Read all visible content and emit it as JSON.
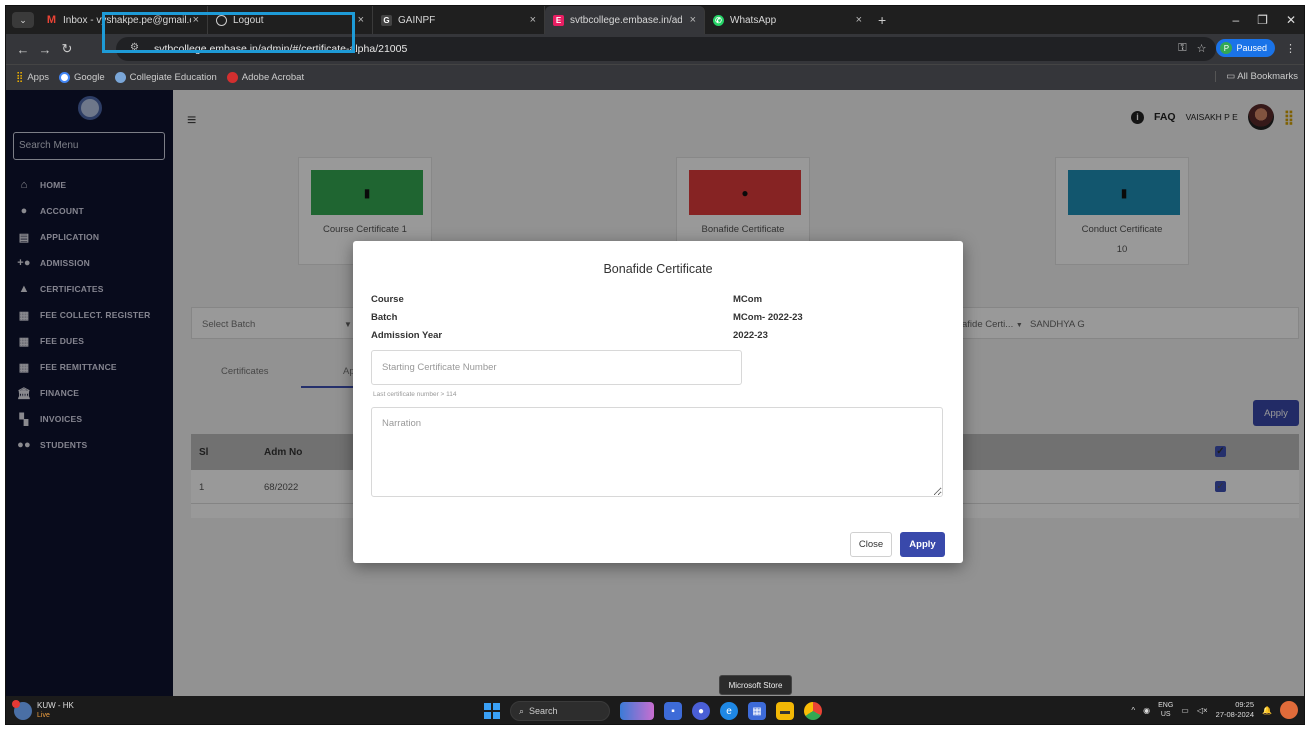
{
  "browser": {
    "tabs": [
      {
        "label": "Inbox - vyshakpe.pe@gmail.co",
        "icon": "gmail-icon",
        "active": false
      },
      {
        "label": "Logout",
        "icon": "globe-icon",
        "active": false
      },
      {
        "label": "GAINPF",
        "icon": "gainpf-icon",
        "active": false
      },
      {
        "label": "svtbcollege.embase.in/admin/#",
        "icon": "embase-icon",
        "active": true
      },
      {
        "label": "WhatsApp",
        "icon": "whatsapp-icon",
        "active": false
      }
    ],
    "new_tab": "+",
    "url": "svtbcollege.embase.in/admin/#/certificate-alpha/21005",
    "profile_status": "Paused",
    "profile_initial": "P",
    "bookmarks": [
      {
        "label": "Apps",
        "icon": "apps-grid-icon"
      },
      {
        "label": "Google",
        "icon": "google-icon"
      },
      {
        "label": "Collegiate Education",
        "icon": "college-icon"
      },
      {
        "label": "Adobe Acrobat",
        "icon": "acrobat-icon"
      }
    ],
    "all_bookmarks": "All Bookmarks"
  },
  "sidebar": {
    "search_placeholder": "Search Menu",
    "items": [
      {
        "label": "HOME",
        "icon": "home-icon"
      },
      {
        "label": "ACCOUNT",
        "icon": "user-icon"
      },
      {
        "label": "APPLICATION",
        "icon": "document-icon"
      },
      {
        "label": "ADMISSION",
        "icon": "add-user-icon"
      },
      {
        "label": "CERTIFICATES",
        "icon": "graduation-cap-icon"
      },
      {
        "label": "FEE COLLECT. REGISTER",
        "icon": "register-icon"
      },
      {
        "label": "FEE DUES",
        "icon": "register-icon"
      },
      {
        "label": "FEE REMITTANCE",
        "icon": "register-icon"
      },
      {
        "label": "FINANCE",
        "icon": "bank-icon"
      },
      {
        "label": "INVOICES",
        "icon": "invoice-icon"
      },
      {
        "label": "STUDENTS",
        "icon": "students-icon"
      }
    ]
  },
  "header": {
    "faq": "FAQ",
    "user": "VAISAKH P E"
  },
  "cards": [
    {
      "title": "Course Certificate 1",
      "count": "",
      "color": "#34a853"
    },
    {
      "title": "Bonafide Certificate",
      "count": "",
      "color": "#e03b3b"
    },
    {
      "title": "Conduct Certificate",
      "count": "10",
      "color": "#1f8fb8"
    }
  ],
  "filter": {
    "batch_placeholder": "Select Batch",
    "certificate_type": "afide Certi...",
    "student": "SANDHYA G"
  },
  "tabs": [
    {
      "label": "Certificates"
    },
    {
      "label": "App"
    }
  ],
  "apply_label": "Apply",
  "table": {
    "columns": [
      "Sl",
      "Adm No"
    ],
    "rows": [
      {
        "sl": "1",
        "adm_no": "68/2022",
        "checked": true
      }
    ],
    "header_checked": true
  },
  "modal": {
    "title": "Bonafide Certificate",
    "fields": [
      {
        "label": "Course",
        "value": "MCom"
      },
      {
        "label": "Batch",
        "value": "MCom- 2022-23"
      },
      {
        "label": "Admission Year",
        "value": "2022-23"
      }
    ],
    "start_number": {
      "placeholder": "Starting Certificate Number",
      "value": ""
    },
    "hint": "Last certificate number > 114",
    "narration": {
      "placeholder": "Narration",
      "value": ""
    },
    "close_label": "Close",
    "apply_label": "Apply"
  },
  "tooltip": "Microsoft Store",
  "taskbar": {
    "weather_title": "KUW - HK",
    "weather_sub": "Live",
    "search": "Search",
    "lang_top": "ENG",
    "lang_bottom": "US",
    "time": "09:25",
    "date": "27-08-2024"
  }
}
